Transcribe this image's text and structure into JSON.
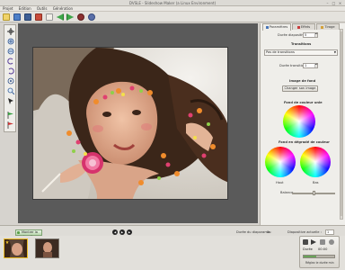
{
  "window": {
    "title": "DVSLE - Slideshow Maker (a Linux Environment)"
  },
  "menu": [
    "Projet",
    "Edition",
    "Outils",
    "Génération"
  ],
  "right_panel": {
    "tabs": [
      "Paramètres",
      "Effets",
      "Tirage"
    ],
    "duree_diapositive_label": "Durée diapositive",
    "duree_diapositive_value": "5",
    "transitions_heading": "Transitions",
    "transition_value": "Pas de transitions",
    "duree_transition_label": "Durée transition",
    "duree_transition_value": "1",
    "image_fond_heading": "Image de fond",
    "changer_image_button": "Changer son image",
    "fond_uni_heading": "Fond de couleur unie",
    "fond_degrade_heading": "Fond en dégradé de couleur",
    "haut_label": "Haut",
    "bas_label": "Bas",
    "balance_label": "Balance",
    "balance_level": 0.5
  },
  "statusbar": {
    "show_navigator_label": "Montrer la vignette",
    "duree_diaporama_label": "Durée du diaporama :",
    "duree_diaporama_value": "0s",
    "diapositive_actuelle_label": "Diapositive actuelle :",
    "diapositive_actuelle_value": "1"
  },
  "transport": {
    "label": "Durée",
    "time": "00:00",
    "progress_label": "Réglez le durée min"
  },
  "colors": {
    "accent": "#5aa04a",
    "canvas": "#5a5a5a"
  }
}
